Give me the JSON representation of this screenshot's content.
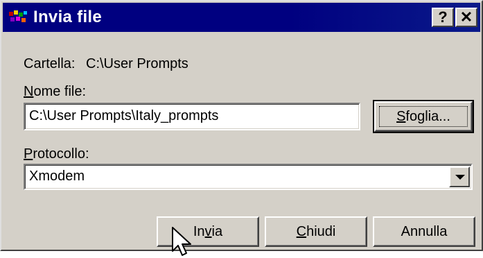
{
  "window": {
    "title": "Invia file",
    "help_label": "?",
    "close_label": "✕"
  },
  "folder": {
    "label": "Cartella:",
    "path": "C:\\User Prompts"
  },
  "filename": {
    "label_accel": "N",
    "label_rest": "ome file:",
    "value": "C:\\User Prompts\\Italy_prompts"
  },
  "browse": {
    "label_accel": "S",
    "label_rest": "foglia..."
  },
  "protocol": {
    "label_accel": "P",
    "label_rest": "rotocollo:",
    "selected": "Xmodem"
  },
  "actions": {
    "send_pre": "In",
    "send_accel": "v",
    "send_post": "ia",
    "close_accel": "C",
    "close_rest": "hiudi",
    "cancel": "Annulla"
  }
}
